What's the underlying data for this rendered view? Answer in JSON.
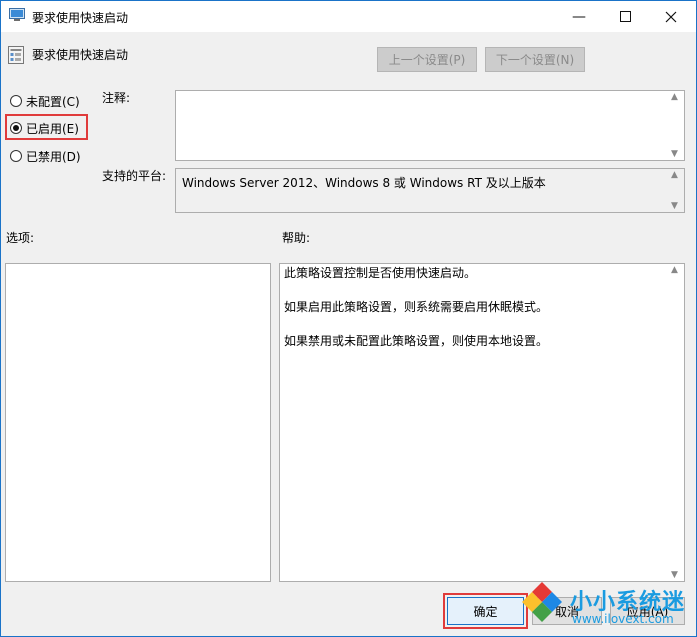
{
  "window": {
    "title": "要求使用快速启动"
  },
  "header": {
    "policy_name": "要求使用快速启动",
    "prev_label": "上一个设置(P)",
    "next_label": "下一个设置(N)"
  },
  "radios": {
    "not_configured": "未配置(C)",
    "enabled": "已启用(E)",
    "disabled": "已禁用(D)",
    "selected": "enabled"
  },
  "comment": {
    "label": "注释:",
    "value": ""
  },
  "platform": {
    "label": "支持的平台:",
    "value": "Windows Server 2012、Windows 8 或 Windows RT 及以上版本"
  },
  "options": {
    "label": "选项:"
  },
  "help": {
    "label": "帮助:",
    "lines": [
      "此策略设置控制是否使用快速启动。",
      "如果启用此策略设置，则系统需要启用休眠模式。",
      "如果禁用或未配置此策略设置，则使用本地设置。"
    ]
  },
  "buttons": {
    "ok": "确定",
    "cancel": "取消",
    "apply": "应用(A)"
  },
  "watermark": {
    "text": "小小系统迷",
    "url": "www.ilovext.com"
  },
  "colors": {
    "highlight": "#e03b3b",
    "accent": "#1a73c8",
    "watermark": "#1a9be0"
  }
}
